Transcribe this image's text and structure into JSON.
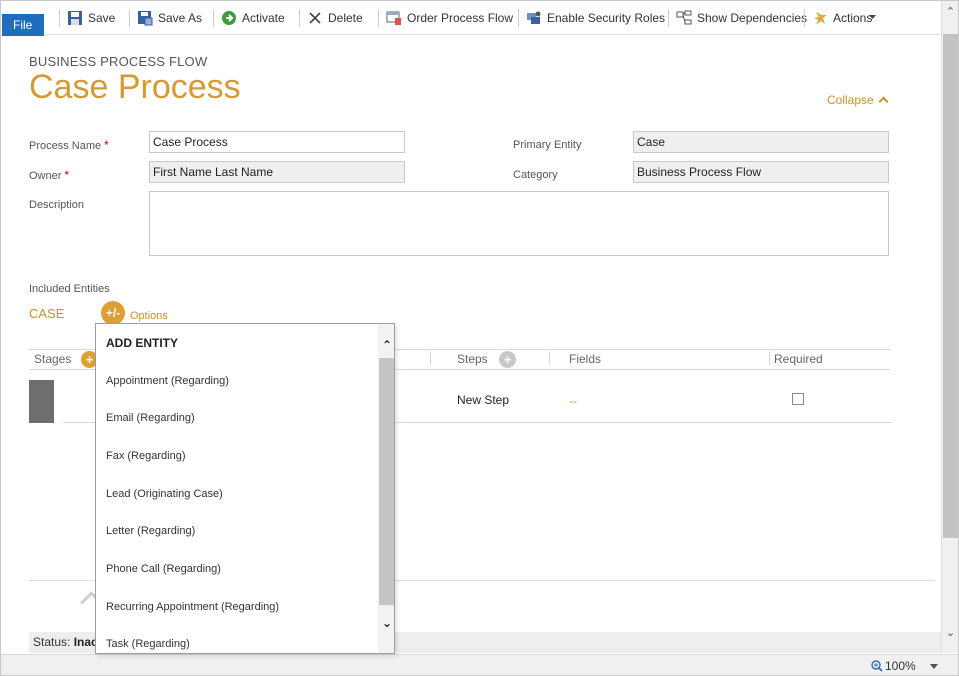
{
  "toolbar": {
    "file_label": "File",
    "save_label": "Save",
    "save_as_label": "Save As",
    "activate_label": "Activate",
    "delete_label": "Delete",
    "order_process_flow_label": "Order Process Flow",
    "enable_security_roles_label": "Enable Security Roles",
    "show_dependencies_label": "Show Dependencies",
    "actions_label": "Actions"
  },
  "header": {
    "eyebrow": "BUSINESS PROCESS FLOW",
    "title": "Case Process",
    "collapse_label": "Collapse"
  },
  "form": {
    "process_name_label": "Process Name",
    "process_name_value": "Case Process",
    "owner_label": "Owner",
    "owner_value": "First Name Last Name",
    "description_label": "Description",
    "primary_entity_label": "Primary Entity",
    "primary_entity_value": "Case",
    "category_label": "Category",
    "category_value": "Business Process Flow",
    "required_marker": "*"
  },
  "entities": {
    "included_label": "Included Entities",
    "current_entity": "CASE",
    "options_button": "+/-",
    "options_label": "Options"
  },
  "grid": {
    "stages_header": "Stages",
    "steps_header": "Steps",
    "fields_header": "Fields",
    "required_header": "Required",
    "row_step": "New Step",
    "row_field": "--"
  },
  "dropdown": {
    "title": "ADD ENTITY",
    "items": [
      "Appointment (Regarding)",
      "Email (Regarding)",
      "Fax (Regarding)",
      "Lead (Originating Case)",
      "Letter (Regarding)",
      "Phone Call (Regarding)",
      "Recurring Appointment (Regarding)",
      "Task (Regarding)"
    ]
  },
  "status": {
    "label": "Status:",
    "value": "Inact"
  },
  "zoom": {
    "level": "100%"
  },
  "colors": {
    "accent": "#d59a32",
    "file_button": "#1e6ebd"
  }
}
